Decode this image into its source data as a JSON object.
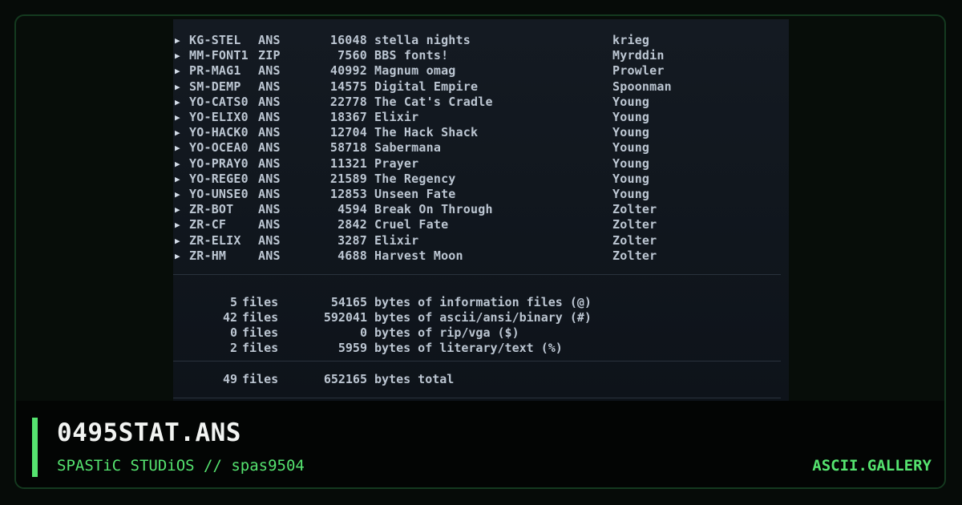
{
  "listing": [
    {
      "name": "KG-STEL",
      "ext": "ANS",
      "size": "16048",
      "desc": "stella nights",
      "author": "krieg"
    },
    {
      "name": "MM-FONT1",
      "ext": "ZIP",
      "size": "7560",
      "desc": "BBS fonts!",
      "author": "Myrddin"
    },
    {
      "name": "PR-MAG1",
      "ext": "ANS",
      "size": "40992",
      "desc": "Magnum omag",
      "author": "Prowler"
    },
    {
      "name": "SM-DEMP",
      "ext": "ANS",
      "size": "14575",
      "desc": "Digital Empire",
      "author": "Spoonman"
    },
    {
      "name": "YO-CATS0",
      "ext": "ANS",
      "size": "22778",
      "desc": "The Cat's Cradle",
      "author": "Young"
    },
    {
      "name": "YO-ELIX0",
      "ext": "ANS",
      "size": "18367",
      "desc": "Elixir",
      "author": "Young"
    },
    {
      "name": "YO-HACK0",
      "ext": "ANS",
      "size": "12704",
      "desc": "The Hack Shack",
      "author": "Young"
    },
    {
      "name": "YO-OCEA0",
      "ext": "ANS",
      "size": "58718",
      "desc": "Sabermana",
      "author": "Young"
    },
    {
      "name": "YO-PRAY0",
      "ext": "ANS",
      "size": "11321",
      "desc": "Prayer",
      "author": "Young"
    },
    {
      "name": "YO-REGE0",
      "ext": "ANS",
      "size": "21589",
      "desc": "The Regency",
      "author": "Young"
    },
    {
      "name": "YO-UNSE0",
      "ext": "ANS",
      "size": "12853",
      "desc": "Unseen Fate",
      "author": "Young"
    },
    {
      "name": "ZR-BOT",
      "ext": "ANS",
      "size": "4594",
      "desc": "Break On Through",
      "author": "Zolter"
    },
    {
      "name": "ZR-CF",
      "ext": "ANS",
      "size": "2842",
      "desc": "Cruel Fate",
      "author": "Zolter"
    },
    {
      "name": "ZR-ELIX",
      "ext": "ANS",
      "size": "3287",
      "desc": "Elixir",
      "author": "Zolter"
    },
    {
      "name": "ZR-HM",
      "ext": "ANS",
      "size": "4688",
      "desc": "Harvest Moon",
      "author": "Zolter"
    }
  ],
  "summary": [
    {
      "count": "5",
      "files": "files",
      "bytes": "54165",
      "desc": "bytes of information files (@)"
    },
    {
      "count": "42",
      "files": "files",
      "bytes": "592041",
      "desc": "bytes of ascii/ansi/binary (#)"
    },
    {
      "count": "0",
      "files": "files",
      "bytes": "0",
      "desc": "bytes of rip/vga ($)"
    },
    {
      "count": "2",
      "files": "files",
      "bytes": "5959",
      "desc": "bytes of literary/text (%)"
    }
  ],
  "total": {
    "count": "49",
    "files": "files",
    "bytes": "652165",
    "desc": "bytes total"
  },
  "bullet_icon": "triangle-bullet-icon",
  "footer": {
    "title": "0495STAT.ANS",
    "group_handle": "SPASTiC STUDiOS // spas9504",
    "site": "ASCII.GALLERY"
  },
  "colors": {
    "accent": "#55e36f",
    "panel": "#10161d",
    "text": "#bcc6d2"
  }
}
